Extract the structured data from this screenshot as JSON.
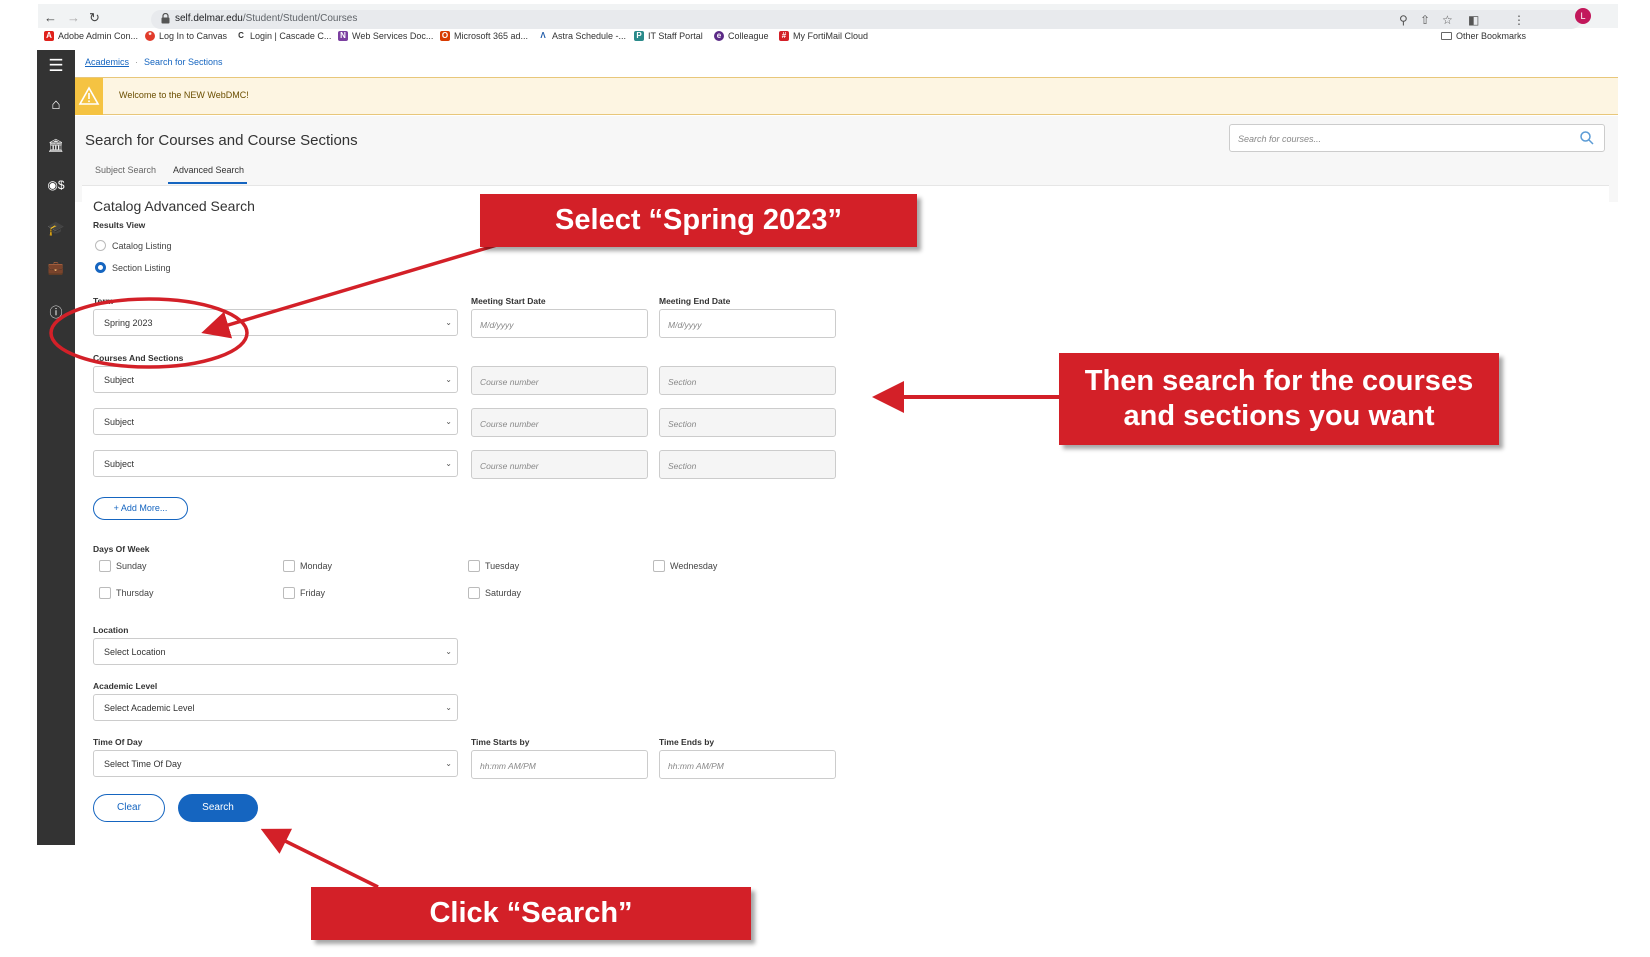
{
  "browser": {
    "url_domain": "self.delmar.edu",
    "url_path": "/Student/Student/Courses",
    "profile_initial": "L",
    "bookmarks": [
      {
        "label": "Adobe Admin Con...",
        "icon": "adobe-icon",
        "color": "#e0211b"
      },
      {
        "label": "Log In to Canvas",
        "icon": "canvas-icon",
        "color": "#e13b2b"
      },
      {
        "label": "Login | Cascade C...",
        "icon": "cascade-icon",
        "color": "#333333"
      },
      {
        "label": "Web Services Doc...",
        "icon": "onenote-icon",
        "color": "#7b3fa0"
      },
      {
        "label": "Microsoft 365 ad...",
        "icon": "office-icon",
        "color": "#d83b01"
      },
      {
        "label": "Astra Schedule -...",
        "icon": "astra-icon",
        "color": "#1e5aa8"
      },
      {
        "label": "IT Staff Portal",
        "icon": "portal-icon",
        "color": "#2a8a8a"
      },
      {
        "label": "Colleague",
        "icon": "colleague-icon",
        "color": "#5b2a86"
      },
      {
        "label": "My FortiMail Cloud",
        "icon": "fortimail-icon",
        "color": "#d32028"
      }
    ],
    "other_bookmarks": "Other Bookmarks"
  },
  "breadcrumb": {
    "home": "Academics",
    "current": "Search for Sections"
  },
  "alert": {
    "text": "Welcome to the NEW WebDMC!"
  },
  "header": {
    "title": "Search for Courses and Course Sections",
    "search_placeholder": "Search for courses..."
  },
  "tabs": {
    "subject": "Subject Search",
    "advanced": "Advanced Search"
  },
  "form": {
    "heading": "Catalog Advanced Search",
    "results_view_label": "Results View",
    "results_options": [
      "Catalog Listing",
      "Section Listing"
    ],
    "term_label": "Term",
    "term_value": "Spring 2023",
    "meeting_start_label": "Meeting Start Date",
    "meeting_end_label": "Meeting End Date",
    "date_placeholder": "M/d/yyyy",
    "courses_label": "Courses And Sections",
    "subject_placeholder": "Subject",
    "course_number_placeholder": "Course number",
    "section_placeholder": "Section",
    "add_more": "Add More...",
    "days_label": "Days Of Week",
    "days": [
      "Sunday",
      "Monday",
      "Tuesday",
      "Wednesday",
      "Thursday",
      "Friday",
      "Saturday"
    ],
    "location_label": "Location",
    "location_value": "Select Location",
    "academic_level_label": "Academic Level",
    "academic_level_value": "Select Academic Level",
    "time_of_day_label": "Time Of Day",
    "time_of_day_value": "Select Time Of Day",
    "time_starts_label": "Time Starts by",
    "time_ends_label": "Time Ends by",
    "time_placeholder": "hh:mm AM/PM",
    "clear": "Clear",
    "search": "Search"
  },
  "annotations": {
    "select_term": "Select “Spring 2023”",
    "search_courses_line1": "Then search for the courses",
    "search_courses_line2": "and sections you want",
    "click_search": "Click “Search”",
    "color": "#d32028"
  }
}
